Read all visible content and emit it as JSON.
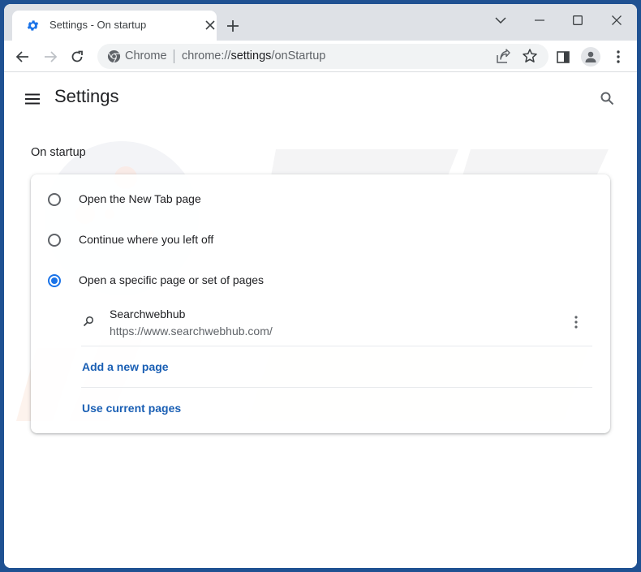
{
  "browser": {
    "tab": {
      "title": "Settings - On startup",
      "icon": "gear-icon",
      "close_icon": "close-icon"
    },
    "new_tab_icon": "plus-icon",
    "window_controls": {
      "tab_search_icon": "chevron-down-icon",
      "minimize_icon": "minimize-icon",
      "maximize_icon": "maximize-icon",
      "close_icon": "close-icon"
    },
    "toolbar": {
      "back_icon": "arrow-left-icon",
      "forward_icon": "arrow-right-icon",
      "reload_icon": "reload-icon",
      "omnibox": {
        "site_label": "Chrome",
        "url_prefix": "chrome://",
        "url_host": "settings",
        "url_path": "/onStartup"
      },
      "share_icon": "share-icon",
      "bookmark_icon": "star-icon",
      "side_panel_icon": "side-panel-icon",
      "profile_icon": "person-icon",
      "menu_icon": "kebab-menu-icon"
    }
  },
  "settings": {
    "header": {
      "menu_icon": "hamburger-icon",
      "title": "Settings",
      "search_icon": "search-icon"
    },
    "section_title": "On startup",
    "options": [
      {
        "label": "Open the New Tab page",
        "checked": false
      },
      {
        "label": "Continue where you left off",
        "checked": false
      },
      {
        "label": "Open a specific page or set of pages",
        "checked": true
      }
    ],
    "startup_pages": [
      {
        "name": "Searchwebhub",
        "url": "https://www.searchwebhub.com/",
        "icon": "search-icon",
        "more_icon": "kebab-menu-icon"
      }
    ],
    "actions": {
      "add_page": "Add a new page",
      "use_current": "Use current pages"
    }
  },
  "colors": {
    "frame": "#1f5192",
    "accent": "#1a73e8",
    "link": "#1a5fb4",
    "tabstrip": "#dee1e6"
  }
}
